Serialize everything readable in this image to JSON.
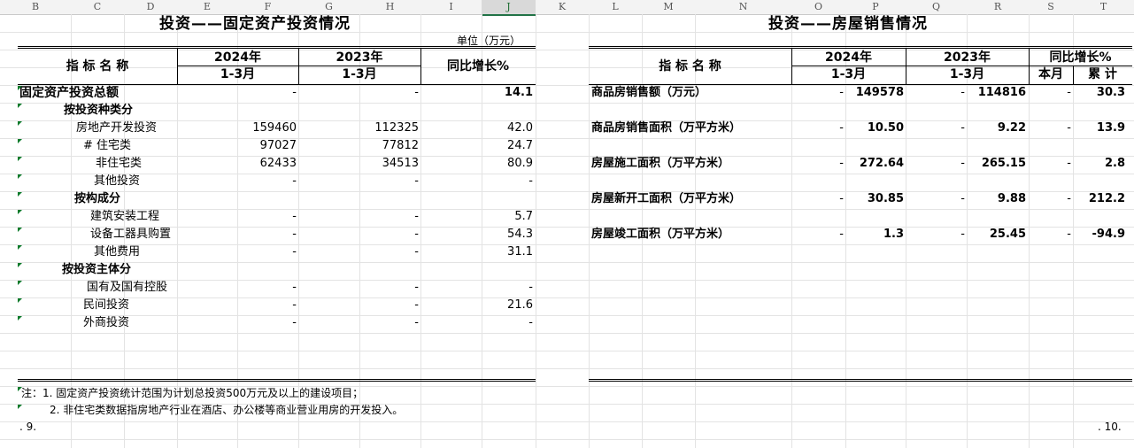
{
  "column_headers": [
    "B",
    "C",
    "D",
    "E",
    "F",
    "G",
    "H",
    "I",
    "J",
    "K",
    "L",
    "M",
    "N",
    "O",
    "P",
    "Q",
    "R",
    "S",
    "T"
  ],
  "left": {
    "title": "投资——固定资产投资情况",
    "unit": "单位（万元）",
    "hdr_indicator": "指 标 名 称",
    "hdr_2024": "2024年",
    "hdr_2023": "2023年",
    "hdr_period": "1-3月",
    "hdr_growth": "同比增长%",
    "rows": [
      {
        "label": "固定资产投资总额",
        "v2024": "-",
        "v2023": "-",
        "growth": "14.1"
      },
      {
        "label": "按投资种类分",
        "v2024": "",
        "v2023": "",
        "growth": ""
      },
      {
        "label": "房地产开发投资",
        "v2024": "159460",
        "v2023": "112325",
        "growth": "42.0"
      },
      {
        "label": "# 住宅类",
        "v2024": "97027",
        "v2023": "77812",
        "growth": "24.7"
      },
      {
        "label": "非住宅类",
        "v2024": "62433",
        "v2023": "34513",
        "growth": "80.9"
      },
      {
        "label": "其他投资",
        "v2024": "-",
        "v2023": "-",
        "growth": "-"
      },
      {
        "label": "按构成分",
        "v2024": "",
        "v2023": "",
        "growth": ""
      },
      {
        "label": "建筑安装工程",
        "v2024": "-",
        "v2023": "-",
        "growth": "5.7"
      },
      {
        "label": "设备工器具购置",
        "v2024": "-",
        "v2023": "-",
        "growth": "54.3"
      },
      {
        "label": "其他费用",
        "v2024": "-",
        "v2023": "-",
        "growth": "31.1"
      },
      {
        "label": "按投资主体分",
        "v2024": "",
        "v2023": "",
        "growth": ""
      },
      {
        "label": "国有及国有控股",
        "v2024": "-",
        "v2023": "-",
        "growth": "-"
      },
      {
        "label": "民间投资",
        "v2024": "-",
        "v2023": "-",
        "growth": "21.6"
      },
      {
        "label": "外商投资",
        "v2024": "-",
        "v2023": "-",
        "growth": "-"
      }
    ],
    "note1": "注：1. 固定资产投资统计范围为计划总投资500万元及以上的建设项目；",
    "note2": "2. 非住宅类数据指房地产行业在酒店、办公楼等商业营业用房的开发投入。",
    "page": ". 9."
  },
  "right": {
    "title": "投资——房屋销售情况",
    "hdr_indicator": "指 标 名 称",
    "hdr_2024": "2024年",
    "hdr_2023": "2023年",
    "hdr_period": "1-3月",
    "hdr_growth": "同比增长%",
    "hdr_month": "本月",
    "hdr_cum": "累 计",
    "rows": [
      {
        "label": "商品房销售额（万元）",
        "m2024": "-",
        "c2024": "149578",
        "m2023": "-",
        "c2023": "114816",
        "gm": "-",
        "gc": "30.3"
      },
      {
        "label": "商品房销售面积（万平方米）",
        "m2024": "-",
        "c2024": "10.50",
        "m2023": "-",
        "c2023": "9.22",
        "gm": "-",
        "gc": "13.9"
      },
      {
        "label": "房屋施工面积（万平方米）",
        "m2024": "-",
        "c2024": "272.64",
        "m2023": "-",
        "c2023": "265.15",
        "gm": "-",
        "gc": "2.8"
      },
      {
        "label": "房屋新开工面积（万平方米）",
        "m2024": "-",
        "c2024": "30.85",
        "m2023": "-",
        "c2023": "9.88",
        "gm": "-",
        "gc": "212.2"
      },
      {
        "label": "房屋竣工面积（万平方米）",
        "m2024": "-",
        "c2024": "1.3",
        "m2023": "-",
        "c2023": "25.45",
        "gm": "-",
        "gc": "-94.9"
      }
    ],
    "page": ". 10."
  }
}
